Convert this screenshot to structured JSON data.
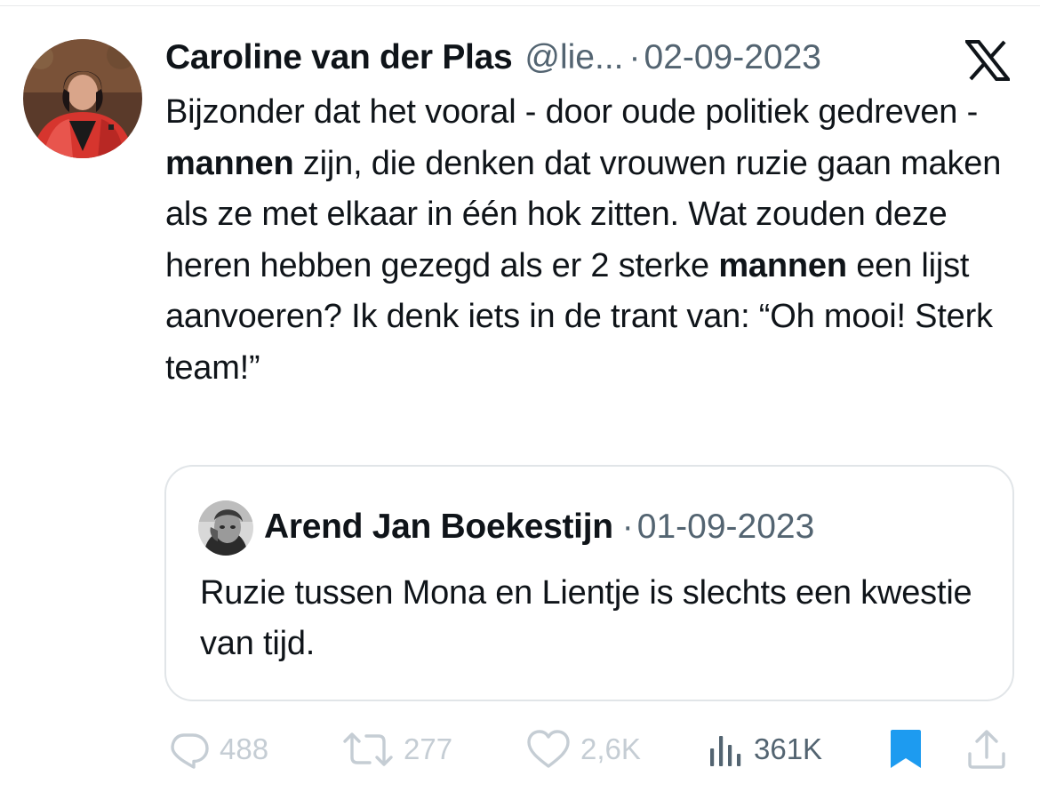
{
  "tweet": {
    "author_name": "Caroline van der Plas",
    "handle": "@lie...",
    "separator": "·",
    "date": "02-09-2023",
    "text_parts": [
      "Bijzonder dat het vooral - door oude politiek gedreven -",
      "mannen",
      " zijn, die denken dat vrouwen ruzie gaan maken als ze met elkaar in één hok zitten. Wat zouden deze heren hebben gezegd als er 2 sterke ",
      "mannen",
      " een lijst aanvoeren? Ik denk iets in de trant van: “Oh mooi! Sterk team!”"
    ]
  },
  "quoted_tweet": {
    "author_name": "Arend Jan Boekestijn",
    "separator": "·",
    "date": "01-09-2023",
    "text": "Ruzie tussen Mona en Lientje is slechts een kwestie van tijd."
  },
  "actions": {
    "replies": "488",
    "retweets": "277",
    "likes": "2,6K",
    "views": "361K"
  },
  "icons": {
    "brand": "x-logo-icon",
    "reply": "speech-bubble-icon",
    "retweet": "retweet-arrows-icon",
    "like": "heart-icon",
    "views": "bar-chart-icon",
    "bookmark": "bookmark-icon",
    "share": "share-upload-icon"
  },
  "colors": {
    "text": "#0f1419",
    "secondary": "#536471",
    "muted": "#c5cdd4",
    "accent": "#1d9bf0",
    "border": "#e1e5e8"
  }
}
